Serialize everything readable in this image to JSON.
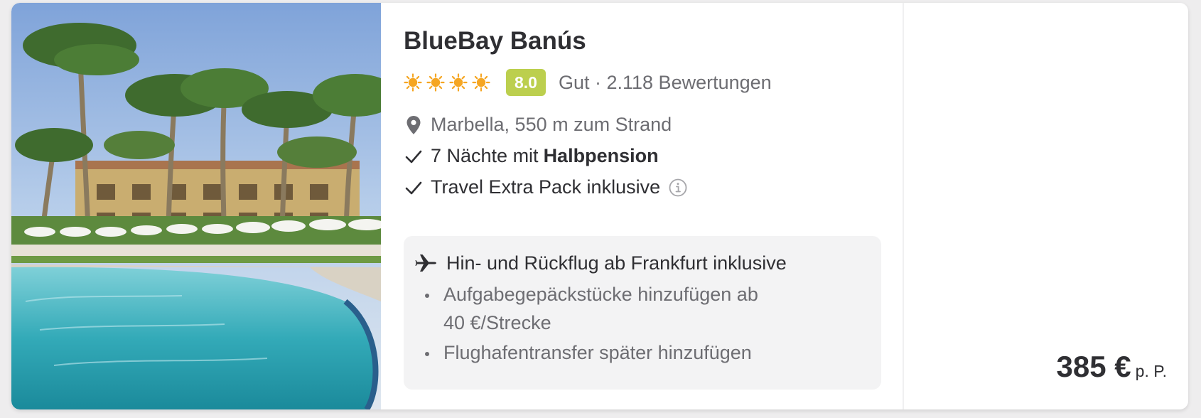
{
  "hotel": {
    "name": "BlueBay Banús",
    "star_icons": [
      "sun-icon",
      "sun-icon",
      "sun-icon",
      "sun-icon"
    ],
    "star_count": 4,
    "score": "8.0",
    "rating_text": "Gut · 2.118 Bewertungen",
    "location": "Marbella, 550 m zum Strand"
  },
  "features": {
    "nights_prefix": "7 Nächte mit",
    "board": "Halbpension",
    "extra_pack": "Travel Extra Pack inklusive"
  },
  "flight": {
    "headline": "Hin- und Rückflug ab Frankfurt inklusive",
    "baggage_line1": "Aufgabegepäckstücke hinzufügen ab",
    "baggage_line2": "40 €/Strecke",
    "transfer": "Flughafentransfer später hinzufügen"
  },
  "price": {
    "amount": "385 €",
    "unit": "p. P."
  },
  "colors": {
    "score_badge": "#bccf4e",
    "sun": "#f5a623",
    "text_primary": "#2f2f33",
    "text_secondary": "#6d6d72"
  },
  "icons": [
    "sun-icon",
    "location-pin-icon",
    "check-icon",
    "info-icon",
    "airplane-icon"
  ]
}
